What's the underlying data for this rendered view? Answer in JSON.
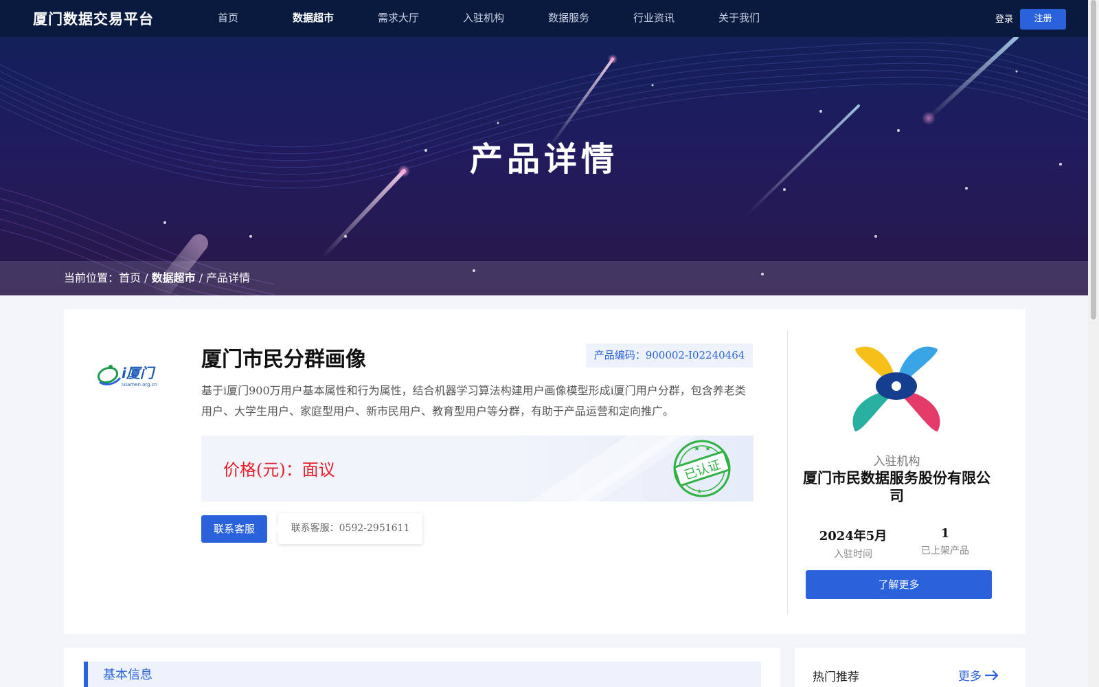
{
  "header": {
    "logo": "厦门数据交易平台",
    "nav": [
      "首页",
      "数据超市",
      "需求大厅",
      "入驻机构",
      "数据服务",
      "行业资讯",
      "关于我们"
    ],
    "active_nav": "数据超市",
    "login": "登录",
    "register": "注册"
  },
  "hero": {
    "title": "产品详情",
    "breadcrumb": {
      "prefix": "当前位置：",
      "home": "首页",
      "sep1": " / ",
      "market": "数据超市",
      "sep2": " / ",
      "current": "产品详情"
    }
  },
  "product": {
    "logo_text": "i厦门",
    "logo_sub": "ixiamen.org.cn",
    "title": "厦门市民分群画像",
    "code": "产品编码：900002-I02240464",
    "description": "基于i厦门900万用户基本属性和行为属性，结合机器学习算法构建用户画像模型形成i厦门用户分群，包含养老类用户、大学生用户、家庭型用户、新市民用户、教育型用户等分群，有助于产品运营和定向推广。",
    "price": "价格(元)：面议",
    "stamp": "已认证",
    "contact_button": "联系客服",
    "contact_tip": "联系客服：0592-2951611"
  },
  "org": {
    "label": "入驻机构",
    "name": "厦门市民数据服务股份有限公司",
    "stats": [
      {
        "value": "2024年5月",
        "label": "入驻时间"
      },
      {
        "value": "1",
        "label": "已上架产品"
      }
    ],
    "more_button": "了解更多"
  },
  "basic_info": {
    "title": "基本信息"
  },
  "hot": {
    "title": "热门推荐",
    "more": "更多"
  },
  "colors": {
    "primary": "#2a62db",
    "price": "#e4222e",
    "stamp": "#2fb144",
    "nav_bg": "#0a1a3e"
  }
}
